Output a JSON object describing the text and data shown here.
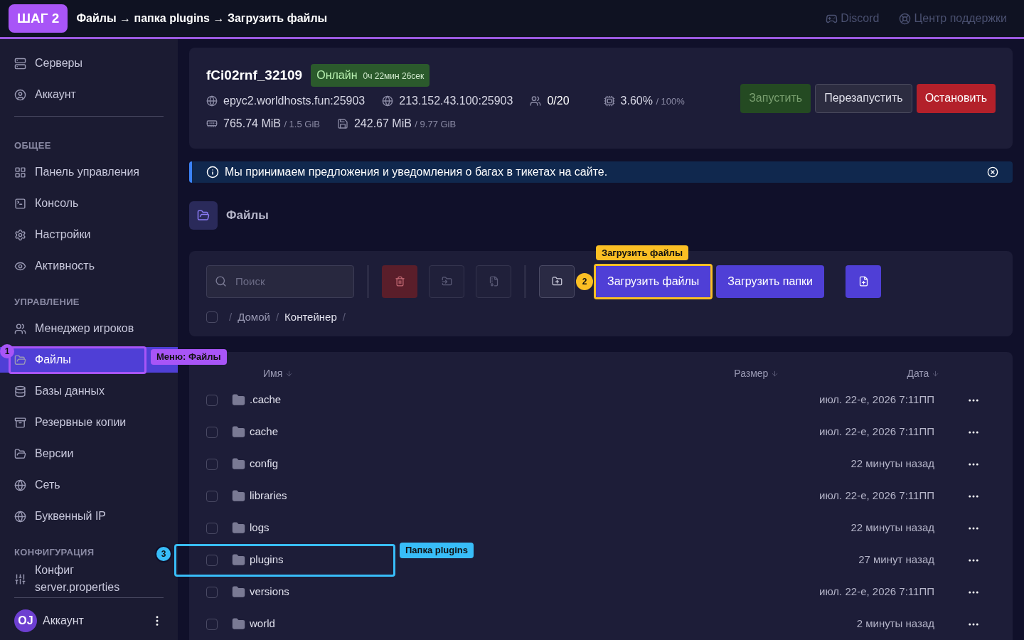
{
  "tutorial": {
    "step": "ШАГ 2",
    "path": "Файлы → папка plugins → Загрузить файлы"
  },
  "header_links": [
    "Discord",
    "Центр поддержки"
  ],
  "sidebar": {
    "sections": [
      {
        "items": [
          {
            "label": "Серверы",
            "selected": false
          },
          {
            "label": "Аккаунт",
            "selected": false
          }
        ]
      },
      {
        "title": "ОБЩЕЕ",
        "items": [
          {
            "label": "Панель управления",
            "selected": false
          },
          {
            "label": "Консоль",
            "selected": false
          },
          {
            "label": "Настройки",
            "selected": false
          },
          {
            "label": "Активность",
            "selected": false
          }
        ]
      },
      {
        "title": "УПРАВЛЕНИЕ",
        "items": [
          {
            "label": "Менеджер игроков",
            "selected": false
          },
          {
            "label": "Файлы",
            "selected": true,
            "annotation": {
              "number": "1",
              "label": "Меню: Файлы",
              "color": "#a855f7"
            }
          },
          {
            "label": "Базы данных",
            "selected": false
          },
          {
            "label": "Резервные копии",
            "selected": false
          },
          {
            "label": "Версии",
            "selected": false
          },
          {
            "label": "Сеть",
            "selected": false
          },
          {
            "label": "Буквенный IP",
            "selected": false
          }
        ]
      },
      {
        "title": "КОНФИГУРАЦИЯ",
        "items": [
          {
            "label": "Конфиг server.properties",
            "selected": false
          }
        ]
      }
    ],
    "account": {
      "initials": "OJ",
      "label": "Аккаунт"
    }
  },
  "server": {
    "name": "fCi02rnf_32109",
    "status": "Онлайн",
    "uptime": "0ч 22мин 26сек",
    "address": "epyc2.worldhosts.fun:25903",
    "ip": "213.152.43.100:25903",
    "players": "0/20",
    "cpu": "3.60%",
    "cpu_limit": "/ 100%",
    "memory": "765.74 MiB",
    "memory_limit": "/ 1.5 GiB",
    "disk": "242.67 MiB",
    "disk_limit": "/ 9.77 GiB",
    "buttons": [
      {
        "kind": "start",
        "label": "Запустить",
        "disabled": true
      },
      {
        "kind": "restart",
        "label": "Перезапустить",
        "disabled": false
      },
      {
        "kind": "stop",
        "label": "Остановить",
        "disabled": false
      }
    ]
  },
  "alert": {
    "text": "Мы принимаем предложения и уведомления о багах в тикетах на сайте."
  },
  "files_title": "Файлы",
  "toolbar": {
    "search": {
      "placeholder": "Поиск"
    },
    "buttons": [
      {
        "kind": "delete",
        "disabled": true
      },
      {
        "kind": "move",
        "disabled": true
      },
      {
        "kind": "archive",
        "disabled": true
      },
      {
        "kind": "new_folder",
        "disabled": false
      },
      {
        "kind": "upload",
        "label": "Загрузить файлы",
        "annotation": {
          "number": "2",
          "label": "Загрузить файлы",
          "color": "#fbbf24"
        }
      },
      {
        "kind": "upload",
        "label": "Загрузить папки"
      },
      {
        "kind": "new_file",
        "disabled": false
      }
    ],
    "breadcrumb": [
      {
        "separator": "/",
        "label": "Домой",
        "selected": false
      },
      {
        "separator": "/",
        "label": "Контейнер",
        "selected": true
      }
    ],
    "breadcrumb_end": "/",
    "select_all": false
  },
  "table": {
    "columns": [
      "Имя",
      "Размер",
      "Дата"
    ],
    "rows": [
      {
        "name": ".cache",
        "date": "июл. 22-е, 2026 7:11ПП",
        "checked": false
      },
      {
        "name": "cache",
        "date": "июл. 22-е, 2026 7:11ПП",
        "checked": false
      },
      {
        "name": "config",
        "date": "22 минуты назад",
        "checked": false
      },
      {
        "name": "libraries",
        "date": "июл. 22-е, 2026 7:11ПП",
        "checked": false
      },
      {
        "name": "logs",
        "date": "22 минуты назад",
        "checked": false
      },
      {
        "name": "plugins",
        "date": "27 минут назад",
        "checked": false,
        "annotation": {
          "number": "3",
          "label": "Папка plugins",
          "color": "#38bdf8"
        }
      },
      {
        "name": "versions",
        "date": "июл. 22-е, 2026 7:11ПП",
        "checked": false
      },
      {
        "name": "world",
        "date": "2 минуты назад",
        "checked": false
      }
    ]
  }
}
